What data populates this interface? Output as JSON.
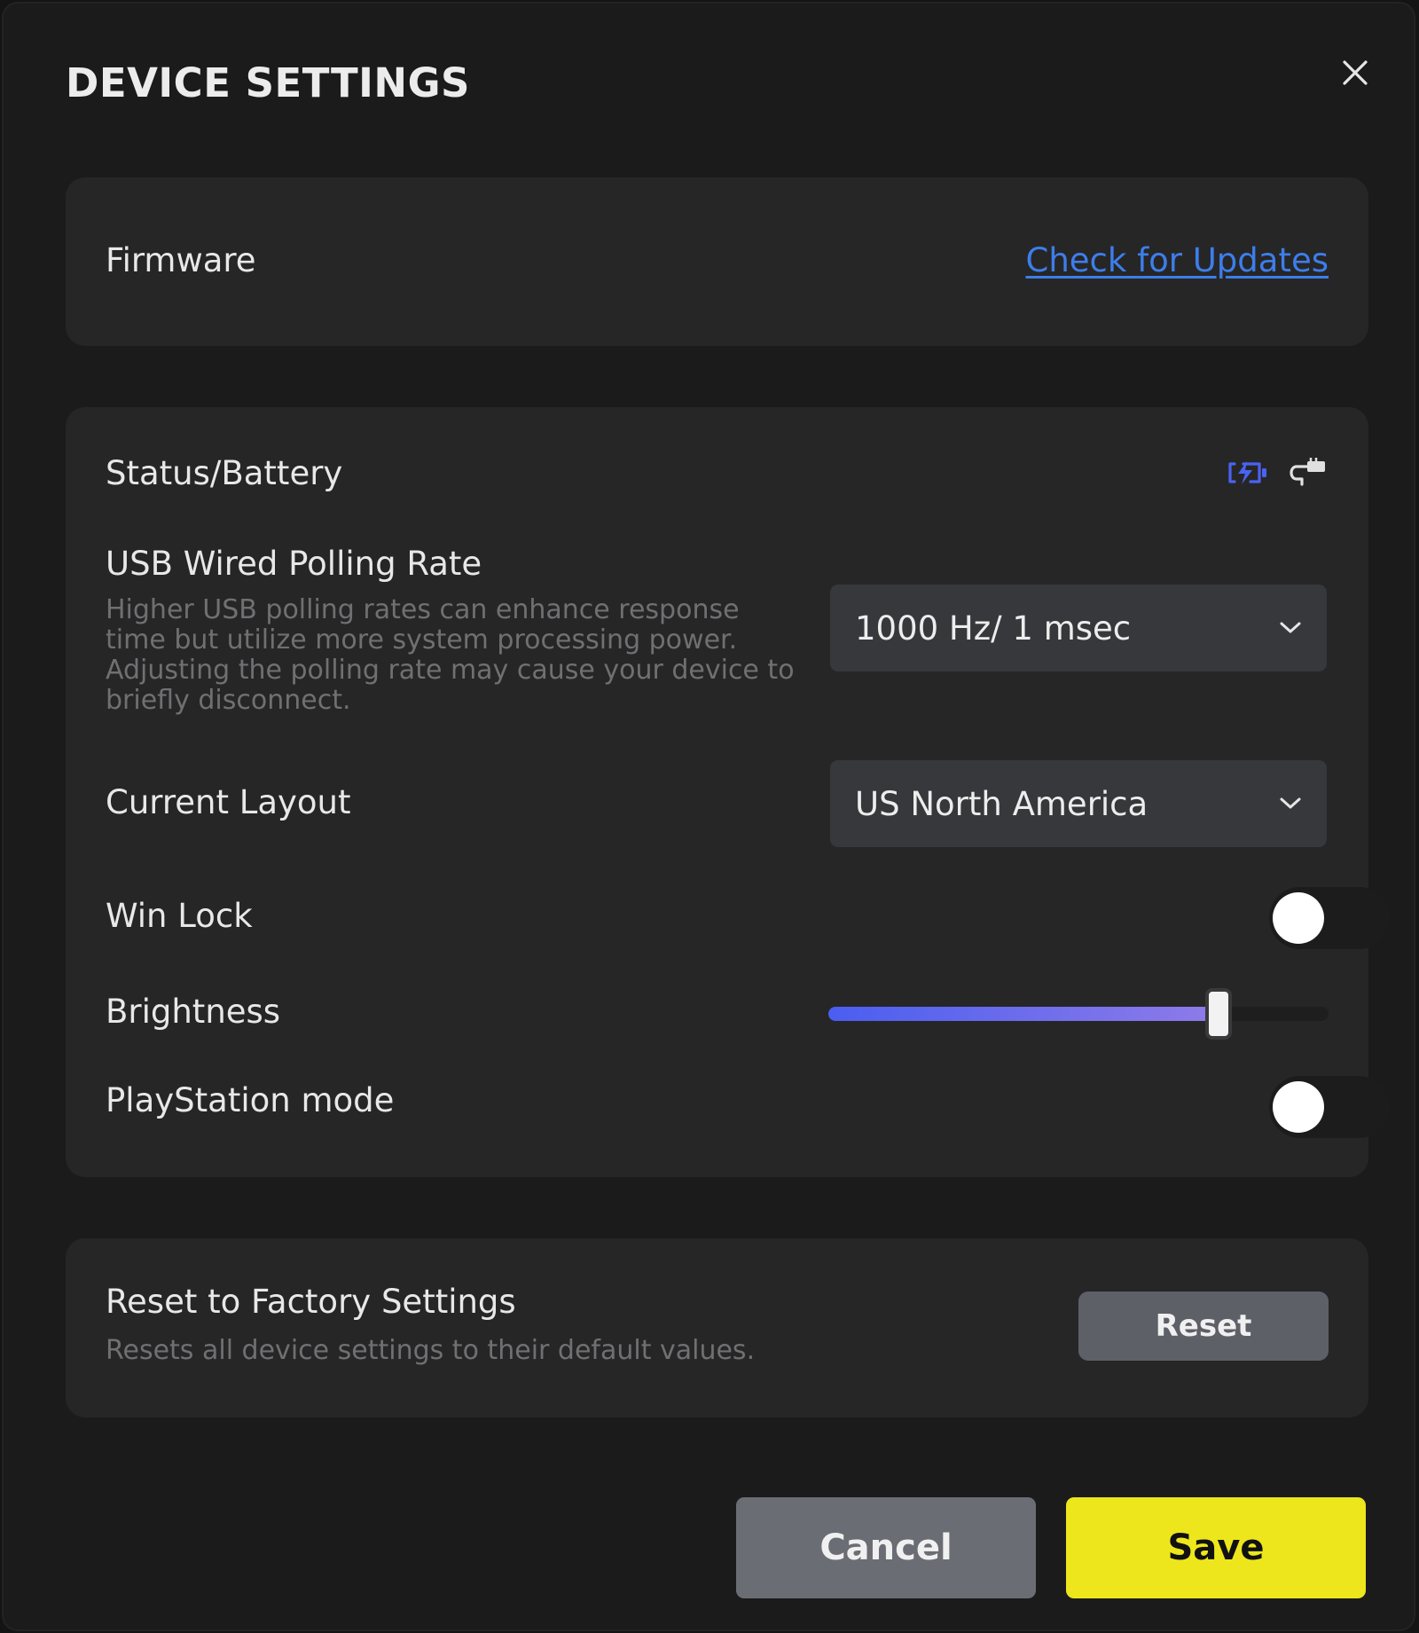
{
  "dialog": {
    "title": "DEVICE SETTINGS"
  },
  "firmware": {
    "label": "Firmware",
    "link_text": "Check for Updates"
  },
  "status": {
    "label": "Status/Battery",
    "icons": [
      "battery-charging-icon",
      "usb-cable-icon"
    ],
    "polling": {
      "label": "USB Wired Polling Rate",
      "description": "Higher USB polling rates can enhance response time but utilize more system processing power. Adjusting the polling rate may cause your device to briefly disconnect.",
      "value": "1000 Hz/ 1 msec"
    },
    "layout": {
      "label": "Current Layout",
      "value": "US North America"
    },
    "win_lock": {
      "label": "Win Lock",
      "enabled": false
    },
    "brightness": {
      "label": "Brightness",
      "level_fraction": 0.78
    },
    "playstation_mode": {
      "label": "PlayStation mode",
      "enabled": false
    }
  },
  "factory_reset": {
    "title": "Reset to Factory Settings",
    "description": "Resets all device settings to their default values.",
    "button_label": "Reset"
  },
  "footer": {
    "cancel_label": "Cancel",
    "save_label": "Save"
  },
  "colors": {
    "accent_link": "#3d7eea",
    "save_button": "#ede61c",
    "battery_icon": "#4a63f2",
    "slider_fill_start": "#4a5ef0",
    "slider_fill_end": "#8f7be8"
  }
}
